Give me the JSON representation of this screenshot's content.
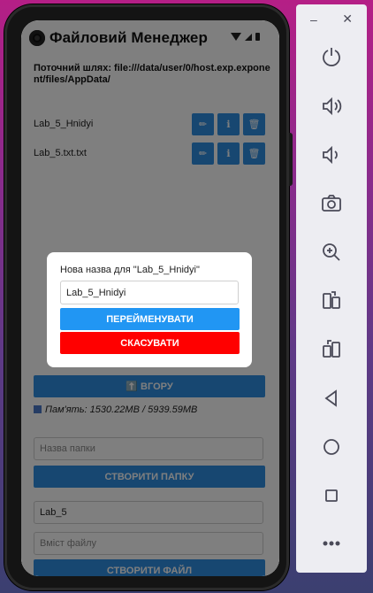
{
  "app": {
    "title": "Файловий Менеджер"
  },
  "path": {
    "text": "Поточний шлях: file:///data/user/0/host.exp.exponent/files/AppData/"
  },
  "files": [
    {
      "name": "Lab_5_Hnidyi"
    },
    {
      "name": "Lab_5.txt.txt"
    }
  ],
  "file_actions": {
    "rename_icon": "pencil-icon",
    "info_icon": "info-icon",
    "delete_icon": "trash-icon"
  },
  "up_button": {
    "label": "⬆️ ВГОРУ"
  },
  "memory": {
    "text": "Пам'ять: 1530.22MB / 5939.59MB"
  },
  "folder": {
    "placeholder": "Назва папки",
    "create_label": "СТВОРИТИ ПАПКУ"
  },
  "file_form": {
    "name_value": "Lab_5",
    "content_placeholder": "Вміст файлу",
    "create_label": "СТВОРИТИ ФАЙЛ"
  },
  "dialog": {
    "label": "Нова назва для \"Lab_5_Hnidyi\"",
    "input_value": "Lab_5_Hnidyi",
    "ok_label": "ПЕРЕЙМЕНУВАТИ",
    "cancel_label": "СКАСУВАТИ"
  },
  "colors": {
    "primary": "#2196f3",
    "danger": "#ff0000"
  },
  "emulator_panel": {
    "minimize": "–",
    "close": "✕",
    "buttons": [
      "power-icon",
      "volume-up-icon",
      "volume-down-icon",
      "camera-icon",
      "zoom-icon",
      "rotate-left-icon",
      "rotate-right-icon",
      "back-icon",
      "home-icon",
      "overview-icon",
      "more-icon"
    ]
  }
}
